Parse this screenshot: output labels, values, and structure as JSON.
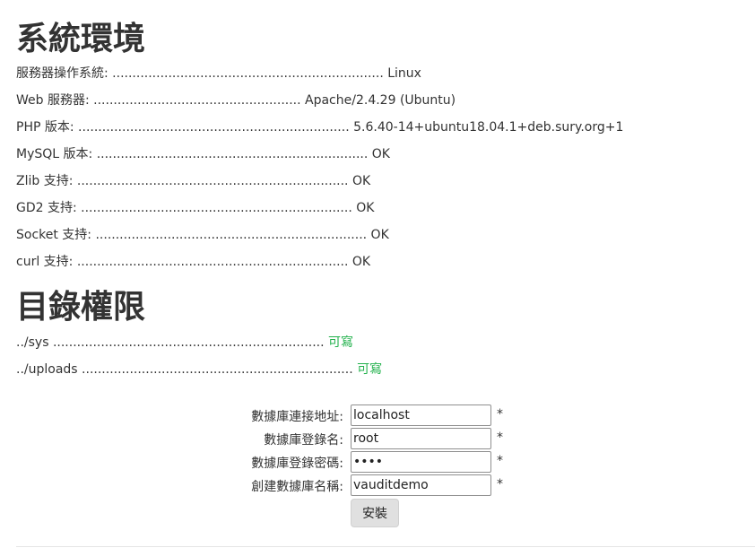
{
  "system_env": {
    "title": "系統環境",
    "items": [
      {
        "label": "服務器操作系統:",
        "dots": " .................................................................... ",
        "value": "Linux"
      },
      {
        "label": "Web 服務器:",
        "dots": " .................................................... ",
        "value": "Apache/2.4.29 (Ubuntu)"
      },
      {
        "label": "PHP 版本:",
        "dots": " .................................................................... ",
        "value": "5.6.40-14+ubuntu18.04.1+deb.sury.org+1"
      },
      {
        "label": "MySQL 版本:",
        "dots": " .................................................................... ",
        "value": "OK"
      },
      {
        "label": "Zlib 支持:",
        "dots": " .................................................................... ",
        "value": "OK"
      },
      {
        "label": "GD2 支持:",
        "dots": " .................................................................... ",
        "value": "OK"
      },
      {
        "label": "Socket 支持:",
        "dots": " .................................................................... ",
        "value": "OK"
      },
      {
        "label": "curl 支持:",
        "dots": " .................................................................... ",
        "value": "OK"
      }
    ]
  },
  "dir_perm": {
    "title": "目錄權限",
    "items": [
      {
        "label": "../sys",
        "dots": " .................................................................... ",
        "value": "可寫"
      },
      {
        "label": "../uploads",
        "dots": " .................................................................... ",
        "value": "可寫"
      }
    ]
  },
  "form": {
    "fields": [
      {
        "label": "數據庫連接地址:",
        "value": "localhost",
        "type": "text",
        "required_mark": "*"
      },
      {
        "label": "數據庫登錄名:",
        "value": "root",
        "type": "text",
        "required_mark": "*"
      },
      {
        "label": "數據庫登錄密碼:",
        "value": "••••",
        "type": "password",
        "required_mark": "*"
      },
      {
        "label": "創建數據庫名稱:",
        "value": "vauditdemo",
        "type": "text",
        "required_mark": "*"
      }
    ],
    "submit_label": "安裝"
  }
}
